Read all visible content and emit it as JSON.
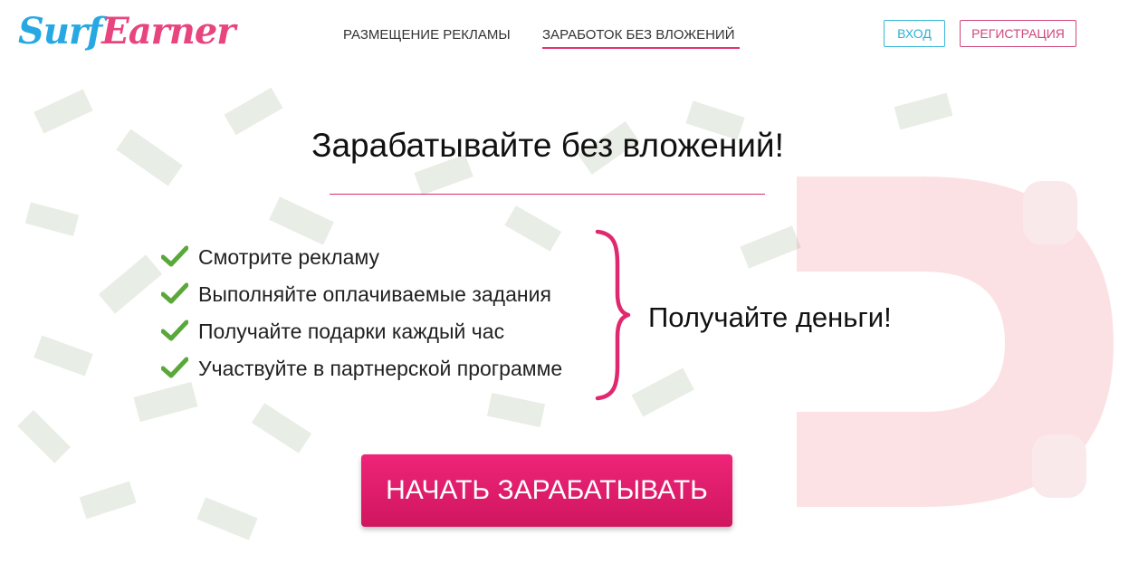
{
  "logo": {
    "part1": "Surf",
    "part2": "Earner"
  },
  "nav": {
    "items": [
      {
        "label": "РАЗМЕЩЕНИЕ РЕКЛАМЫ",
        "active": false
      },
      {
        "label": "ЗАРАБОТОК БЕЗ ВЛОЖЕНИЙ",
        "active": true
      }
    ],
    "login_label": "ВХОД",
    "register_label": "РЕГИСТРАЦИЯ"
  },
  "hero": {
    "title": "Зарабатывайте без вложений!",
    "features": [
      "Смотрите рекламу",
      "Выполняйте оплачиваемые задания",
      "Получайте подарки каждый час",
      "Участвуйте в партнерской программе"
    ],
    "result": "Получайте деньги!",
    "cta_label": "НАЧАТЬ ЗАРАБАТЫВАТЬ"
  },
  "icons": {
    "check": "check-icon",
    "brace": "curly-brace-icon",
    "magnet": "magnet-icon",
    "money": "money-bills"
  },
  "colors": {
    "accent_pink": "#e0356f",
    "accent_blue": "#27a8e2",
    "check_green": "#5aa83a",
    "cta_start": "#ee2478",
    "cta_end": "#d0165f"
  }
}
